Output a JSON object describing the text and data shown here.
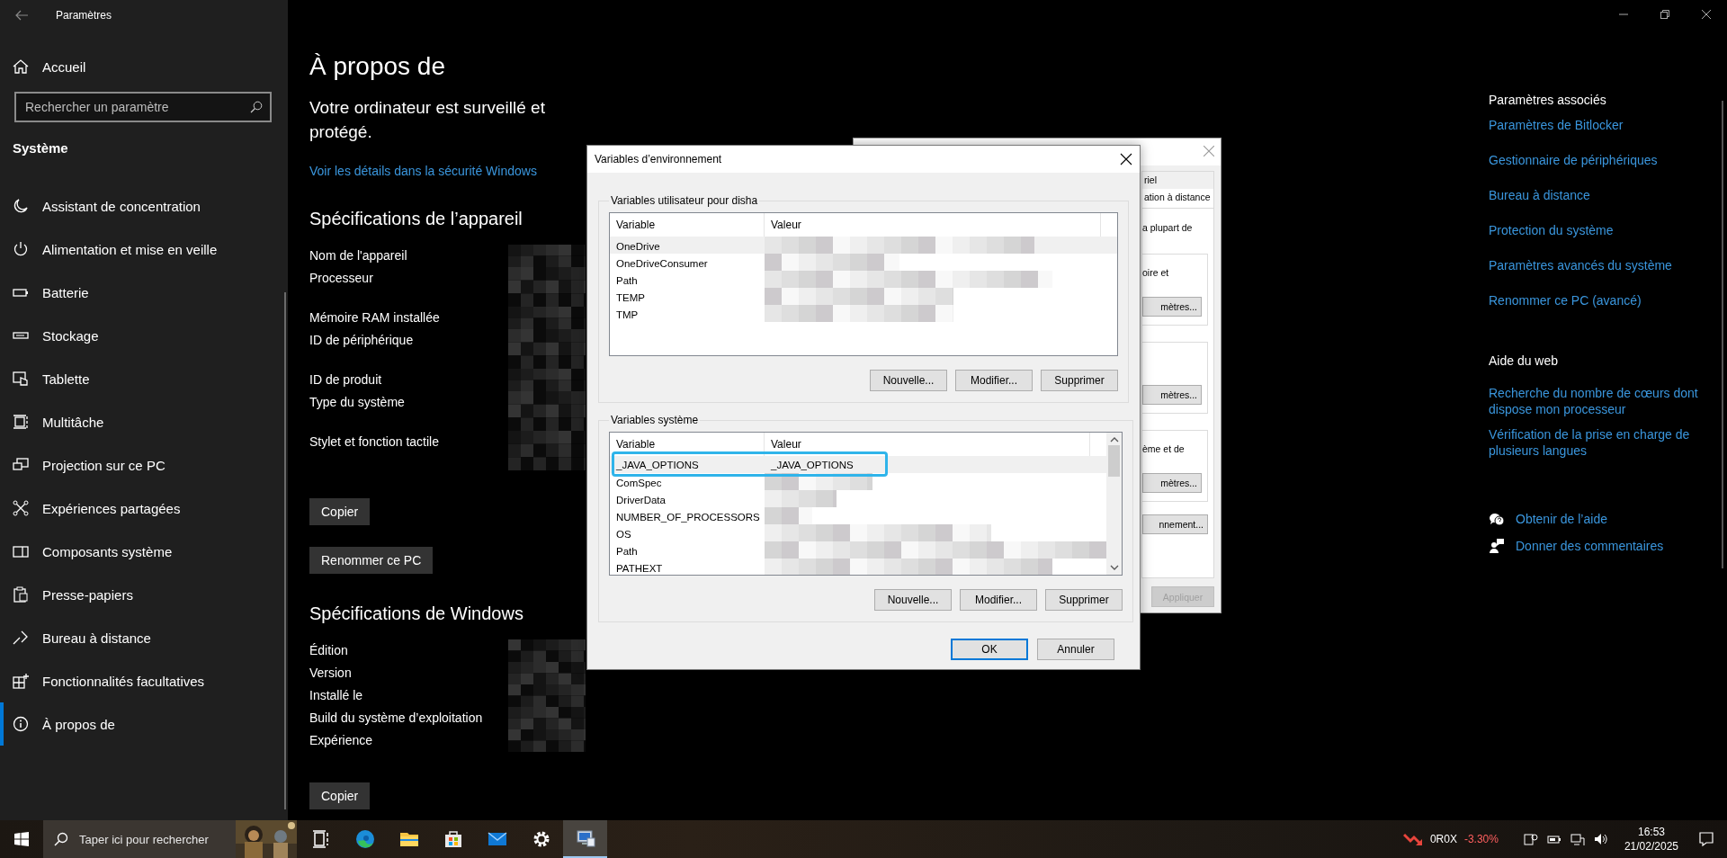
{
  "window": {
    "title": "Paramètres"
  },
  "sidebar": {
    "home": "Accueil",
    "search": {
      "placeholder": "Rechercher un paramètre"
    },
    "section": "Système",
    "items": [
      {
        "label": "Assistant de concentration",
        "selected": false
      },
      {
        "label": "Alimentation et mise en veille",
        "selected": false
      },
      {
        "label": "Batterie",
        "selected": false
      },
      {
        "label": "Stockage",
        "selected": false
      },
      {
        "label": "Tablette",
        "selected": false
      },
      {
        "label": "Multitâche",
        "selected": false
      },
      {
        "label": "Projection sur ce PC",
        "selected": false
      },
      {
        "label": "Expériences partagées",
        "selected": false
      },
      {
        "label": "Composants système",
        "selected": false
      },
      {
        "label": "Presse-papiers",
        "selected": false
      },
      {
        "label": "Bureau à distance",
        "selected": false
      },
      {
        "label": "Fonctionnalités facultatives",
        "selected": false
      },
      {
        "label": "À propos de",
        "selected": true
      }
    ]
  },
  "main": {
    "title": "À propos de",
    "status": "Votre ordinateur est surveillé et protégé.",
    "security_link": "Voir les détails dans la sécurité Windows",
    "device_specs": {
      "heading": "Spécifications de l’appareil",
      "rows": [
        {
          "label": "Nom de l'appareil",
          "kind": "single"
        },
        {
          "label": "Processeur",
          "kind": "double"
        },
        {
          "label": "Mémoire RAM installée",
          "kind": "single"
        },
        {
          "label": "ID de périphérique",
          "kind": "double"
        },
        {
          "label": "ID de produit",
          "kind": "single"
        },
        {
          "label": "Type du système",
          "kind": "double"
        },
        {
          "label": "Stylet et fonction tactile",
          "kind": "double"
        }
      ],
      "copy_button": "Copier",
      "rename_button": "Renommer ce PC"
    },
    "windows_specs": {
      "heading": "Spécifications de Windows",
      "rows": [
        {
          "label": "Édition",
          "kind": "single"
        },
        {
          "label": "Version",
          "kind": "single"
        },
        {
          "label": "Installé le",
          "kind": "single"
        },
        {
          "label": "Build du système d’exploitation",
          "kind": "single"
        },
        {
          "label": "Expérience",
          "kind": "single"
        }
      ],
      "copy_button": "Copier"
    }
  },
  "related": {
    "heading": "Paramètres associés",
    "links": [
      "Paramètres de Bitlocker",
      "Gestionnaire de périphériques",
      "Bureau à distance",
      "Protection du système",
      "Paramètres avancés du système",
      "Renommer ce PC (avancé)"
    ]
  },
  "web_help": {
    "heading": "Aide du web",
    "links": [
      "Recherche du nombre de cœurs dont dispose mon processeur",
      "Vérification de la prise en charge de plusieurs langues"
    ]
  },
  "support": [
    "Obtenir de l’aide",
    "Donner des commentaires"
  ],
  "back_dialog": {
    "tabs": [
      {
        "label": "riel",
        "selected": false
      },
      {
        "label": "ation à distance",
        "selected": true
      }
    ],
    "intro": "a plupart de",
    "groups": [
      {
        "text": "oire et",
        "button": "mètres..."
      },
      {
        "button": "mètres..."
      },
      {
        "text": "ème et de",
        "button": "mètres..."
      }
    ],
    "env_button": "nnement...",
    "apply_button": {
      "label": "Appliquer",
      "disabled": true
    }
  },
  "env_dialog": {
    "title": "Variables d’environnement",
    "user_group": {
      "title": "Variables utilisateur pour disha",
      "columns": [
        "Variable",
        "Valeur"
      ],
      "rows": [
        {
          "variable": "OneDrive",
          "selected": true,
          "highlighted": false
        },
        {
          "variable": "OneDriveConsumer",
          "selected": false,
          "highlighted": false
        },
        {
          "variable": "Path",
          "selected": false,
          "highlighted": false
        },
        {
          "variable": "TEMP",
          "selected": false,
          "highlighted": false
        },
        {
          "variable": "TMP",
          "selected": false,
          "highlighted": false
        }
      ],
      "buttons": [
        "Nouvelle...",
        "Modifier...",
        "Supprimer"
      ]
    },
    "system_group": {
      "title": "Variables système",
      "columns": [
        "Variable",
        "Valeur"
      ],
      "rows": [
        {
          "variable": "_JAVA_OPTIONS",
          "value": "_JAVA_OPTIONS",
          "selected": true,
          "highlighted": true
        },
        {
          "variable": "ComSpec",
          "selected": false,
          "highlighted": false
        },
        {
          "variable": "DriverData",
          "selected": false,
          "highlighted": false
        },
        {
          "variable": "NUMBER_OF_PROCESSORS",
          "selected": false,
          "highlighted": false
        },
        {
          "variable": "OS",
          "selected": false,
          "highlighted": false
        },
        {
          "variable": "Path",
          "selected": false,
          "highlighted": false
        },
        {
          "variable": "PATHEXT",
          "selected": false,
          "highlighted": false
        }
      ],
      "buttons": [
        "Nouvelle...",
        "Modifier...",
        "Supprimer"
      ]
    },
    "buttons": [
      {
        "label": "OK",
        "default": true
      },
      {
        "label": "Annuler",
        "default": false
      }
    ]
  },
  "taskbar": {
    "search": {
      "placeholder": "Taper ici pour rechercher"
    },
    "apps": [
      {
        "selected": false
      },
      {
        "selected": false
      },
      {
        "selected": false
      },
      {
        "selected": false
      },
      {
        "selected": false
      },
      {
        "selected": false
      },
      {
        "selected": true
      }
    ],
    "stock": {
      "symbol": "0R0X",
      "change": "-3.30%"
    },
    "clock": {
      "time": "16:53",
      "date": "21/02/2025"
    }
  }
}
